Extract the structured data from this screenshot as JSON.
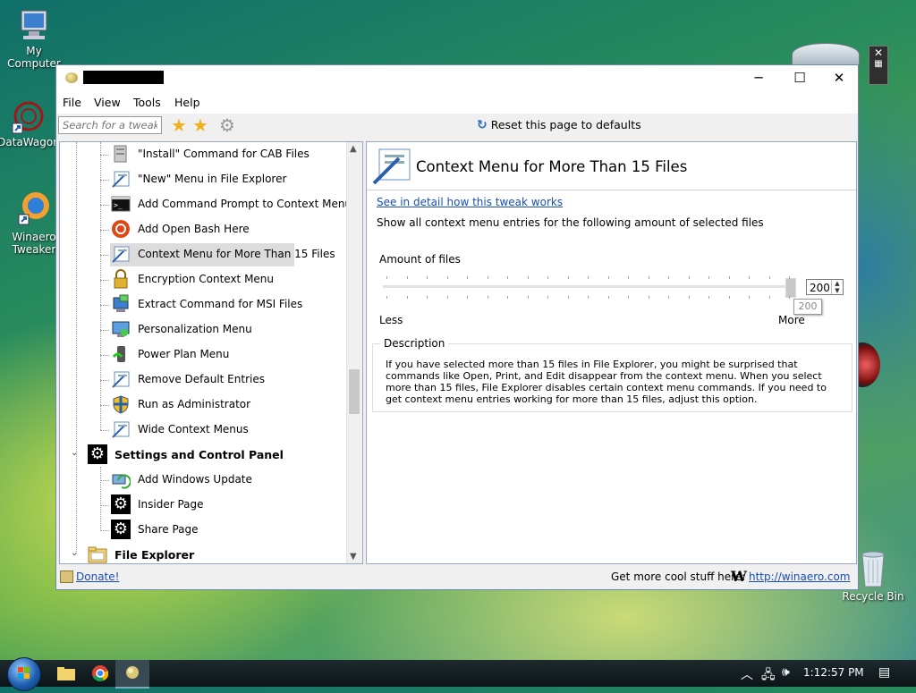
{
  "desktop": {
    "icons": [
      {
        "label": "My Computer"
      },
      {
        "label": "DataWagon"
      },
      {
        "label": "Winaero Tweaker"
      },
      {
        "label": "Recycle Bin"
      }
    ]
  },
  "window": {
    "controls": {
      "minimize": "─",
      "maximize": "☐",
      "close": "✕"
    },
    "menu": [
      "File",
      "View",
      "Tools",
      "Help"
    ],
    "toolbar": {
      "search_placeholder": "Search for a tweak...",
      "reset_label": "Reset this page to defaults"
    },
    "tree": {
      "items": [
        {
          "label": "\"Install\" Command for CAB Files",
          "icon": "cab-icon"
        },
        {
          "label": "\"New\" Menu in File Explorer",
          "icon": "context-menu-icon"
        },
        {
          "label": "Add Command Prompt to Context Menu",
          "icon": "command-prompt-icon"
        },
        {
          "label": "Add Open Bash Here",
          "icon": "ubuntu-icon"
        },
        {
          "label": "Context Menu for More Than 15 Files",
          "icon": "context-menu-icon",
          "selected": true
        },
        {
          "label": "Encryption Context Menu",
          "icon": "lock-icon"
        },
        {
          "label": "Extract Command for MSI Files",
          "icon": "msi-icon"
        },
        {
          "label": "Personalization Menu",
          "icon": "personalization-icon"
        },
        {
          "label": "Power Plan Menu",
          "icon": "power-plan-icon"
        },
        {
          "label": "Remove Default Entries",
          "icon": "context-menu-icon"
        },
        {
          "label": "Run as Administrator",
          "icon": "shield-icon"
        },
        {
          "label": "Wide Context Menus",
          "icon": "context-menu-icon"
        }
      ],
      "category_settings": "Settings and Control Panel",
      "settings_items": [
        {
          "label": "Add Windows Update",
          "icon": "windows-update-icon"
        },
        {
          "label": "Insider Page",
          "icon": "gear-icon"
        },
        {
          "label": "Share Page",
          "icon": "gear-icon"
        }
      ],
      "category_explorer": "File Explorer"
    },
    "panel": {
      "title": "Context Menu for More Than 15 Files",
      "detail_link": "See in detail how this tweak works",
      "instruction": "Show all context menu entries for the following amount of selected files",
      "amount_label": "Amount of files",
      "slider_value": "200",
      "tooltip_value": "200",
      "less_label": "Less",
      "more_label": "More",
      "description_title": "Description",
      "description_text": "If you have selected more than 15 files in File Explorer, you might be surprised that commands like Open, Print, and Edit disappear from the context menu. When you select more than 15 files, File Explorer disables certain context menu commands. If you need to get context menu entries working for more than 15 files, adjust this option."
    },
    "status": {
      "donate": "Donate!",
      "get_more": "Get more cool stuff here:",
      "logo": "W",
      "url": "http://winaero.com"
    }
  },
  "taskbar": {
    "clock": "1:12:57 PM"
  },
  "colors": {
    "link": "#1a4fb5",
    "selected_row": "#dcdcdc",
    "taskbar": "#0c1417"
  }
}
